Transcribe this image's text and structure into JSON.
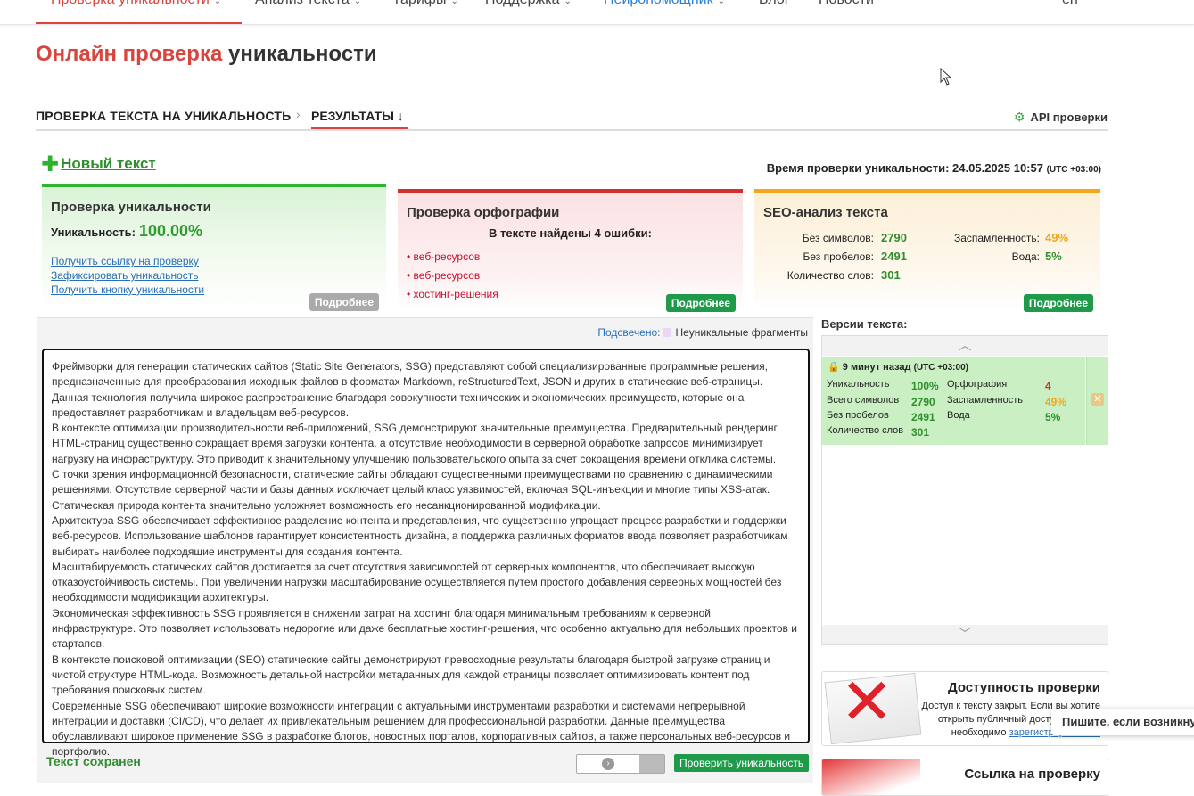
{
  "nav": {
    "items": [
      {
        "label": "Проверка уникальности",
        "chevron": true,
        "style": "active"
      },
      {
        "label": "Анализ текста",
        "chevron": true,
        "style": ""
      },
      {
        "label": "Тарифы",
        "chevron": true,
        "style": ""
      },
      {
        "label": "Поддержка",
        "chevron": true,
        "style": ""
      },
      {
        "label": "Нейропомощник",
        "chevron": true,
        "style": "blue"
      },
      {
        "label": "Блог",
        "chevron": false,
        "style": ""
      },
      {
        "label": "Новости",
        "chevron": false,
        "style": ""
      }
    ],
    "lang": "en"
  },
  "title": {
    "part1": "Онлайн проверка",
    "part2": "уникальности"
  },
  "tabs": {
    "check": "ПРОВЕРКА ТЕКСТА НА УНИКАЛЬНОСТЬ",
    "separator": "›",
    "results": "РЕЗУЛЬТАТЫ ↓",
    "api": "API проверки"
  },
  "new_text": "Новый текст",
  "check_time": {
    "label": "Время проверки уникальности: 24.05.2025 10:57",
    "tz": "(UTC +03:00)"
  },
  "uniqueness_card": {
    "title": "Проверка уникальности",
    "label": "Уникальность:",
    "value": "100.00%",
    "links": [
      "Получить ссылку на проверку",
      "Зафиксировать уникальность",
      "Получить кнопку уникальности"
    ],
    "more": "Подробнее"
  },
  "spelling_card": {
    "title": "Проверка орфографии",
    "summary": "В тексте найдены 4 ошибки:",
    "errors": [
      "веб-ресурсов",
      "веб-ресурсов",
      "хостинг-решения"
    ],
    "more": "Подробнее"
  },
  "seo_card": {
    "title": "SEO-анализ текста",
    "chars_label": "Без символов:",
    "chars": "2790",
    "nospace_label": "Без пробелов:",
    "nospace": "2491",
    "words_label": "Количество слов:",
    "words": "301",
    "spam_label": "Заспамленность:",
    "spam": "49%",
    "water_label": "Вода:",
    "water": "5%",
    "more": "Подробнее"
  },
  "highlight": {
    "label": "Подсвечено:",
    "legend": "Неуникальные фрагменты"
  },
  "text_paragraphs": [
    "Фреймворки для генерации статических сайтов (Static Site Generators, SSG) представляют собой специализированные программные решения, предназначенные для преобразования исходных файлов в форматах Markdown, reStructuredText, JSON и других в статические веб-страницы. Данная технология получила широкое распространение благодаря совокупности технических и экономических преимуществ, которые она предоставляет разработчикам и владельцам веб-ресурсов.",
    "В контексте оптимизации производительности веб-приложений, SSG демонстрируют значительные преимущества. Предварительный рендеринг HTML-страниц существенно сокращает время загрузки контента, а отсутствие необходимости в серверной обработке запросов минимизирует нагрузку на инфраструктуру. Это приводит к значительному улучшению пользовательского опыта за счет сокращения времени отклика системы.",
    "С точки зрения информационной безопасности, статические сайты обладают существенными преимуществами по сравнению с динамическими решениями. Отсутствие серверной части и базы данных исключает целый класс уязвимостей, включая SQL-инъекции и многие типы XSS-атак. Статическая природа контента значительно усложняет возможность его несанкционированной модификации.",
    "Архитектура SSG обеспечивает эффективное разделение контента и представления, что существенно упрощает процесс разработки и поддержки веб-ресурсов. Использование шаблонов гарантирует консистентность дизайна, а поддержка различных форматов ввода позволяет разработчикам выбирать наиболее подходящие инструменты для создания контента.",
    "Масштабируемость статических сайтов достигается за счет отсутствия зависимостей от серверных компонентов, что обеспечивает высокую отказоустойчивость системы. При увеличении нагрузки масштабирование осуществляется путем простого добавления серверных мощностей без необходимости модификации архитектуры.",
    "Экономическая эффективность SSG проявляется в снижении затрат на хостинг благодаря минимальным требованиям к серверной инфраструктуре. Это позволяет использовать недорогие или даже бесплатные хостинг-решения, что особенно актуально для небольших проектов и стартапов.",
    "В контексте поисковой оптимизации (SEO) статические сайты демонстрируют превосходные результаты благодаря быстрой загрузке страниц и чистой структуре HTML-кода. Возможность детальной настройки метаданных для каждой страницы позволяет оптимизировать контент под требования поисковых систем.",
    "Современные SSG обеспечивают широкие возможности интеграции с актуальными инструментами разработки и системами непрерывной интеграции и доставки (CI/CD), что делает их привлекательным решением для профессиональной разработки. Данные преимущества обуславливают широкое применение SSG в разработке блогов, новостных порталов, корпоративных сайтов, а также персональных веб-ресурсов и портфолио."
  ],
  "saved": "Текст сохранен",
  "check_button": "Проверить уникальность",
  "versions": {
    "title": "Версии текста:",
    "entry": {
      "time": "9 минут назад",
      "tz": "(UTC +03:00)",
      "uniq_label": "Уникальность",
      "uniq": "100%",
      "chars_label": "Всего символов",
      "chars": "2790",
      "nospace_label": "Без пробелов",
      "nospace": "2491",
      "words_label": "Количество слов",
      "words": "301",
      "spell_label": "Орфография",
      "spell": "4",
      "spam_label": "Заспамленность",
      "spam": "49%",
      "water_label": "Вода",
      "water": "5%"
    }
  },
  "promo_access": {
    "title": "Доступность проверки",
    "line1": "Доступ к тексту закрыт. Если вы хотите",
    "line2": "открыть публичный доступ к тексту,",
    "line3_prefix": "необходимо",
    "line3_link": "зарегистрироваться"
  },
  "promo_link": {
    "title": "Ссылка на проверку"
  },
  "chat": "Пишите, если возникнут вопросы"
}
